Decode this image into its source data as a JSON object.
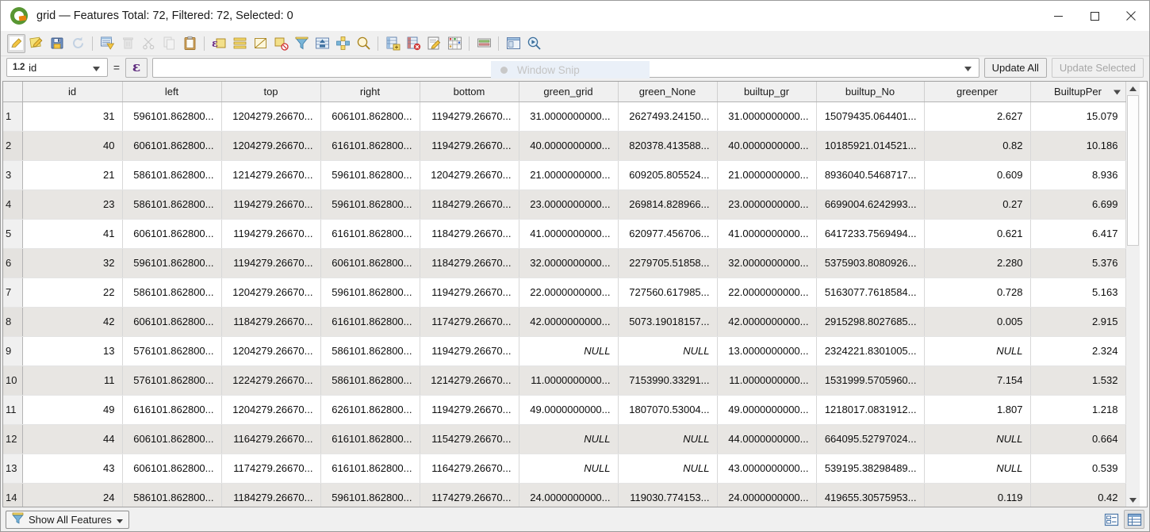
{
  "window": {
    "title": "grid — Features Total: 72, Filtered: 72, Selected: 0",
    "app_icon": "qgis-logo-icon",
    "minimize_label": "Minimize",
    "maximize_label": "Maximize",
    "close_label": "Close"
  },
  "toolbar": {
    "items": [
      {
        "name": "toggle-editing-icon",
        "tip": "Toggle editing mode",
        "state": "active"
      },
      {
        "name": "save-edits-icon",
        "tip": "Save edits",
        "state": "enabled"
      },
      {
        "name": "save-layer-edits-icon",
        "tip": "Save layer edits",
        "state": "enabled"
      },
      {
        "name": "reload-table-icon",
        "tip": "Reload the table",
        "state": "disabled"
      },
      {
        "name": "separator",
        "tip": "",
        "state": ""
      },
      {
        "name": "select-by-expression-icon",
        "tip": "Select features using an expression",
        "state": "enabled"
      },
      {
        "name": "delete-selected-icon",
        "tip": "Delete selected features",
        "state": "disabled"
      },
      {
        "name": "cut-features-icon",
        "tip": "Cut selected features to clipboard",
        "state": "disabled"
      },
      {
        "name": "copy-features-icon",
        "tip": "Copy selected features to clipboard",
        "state": "disabled"
      },
      {
        "name": "paste-features-icon",
        "tip": "Paste features from clipboard",
        "state": "enabled"
      },
      {
        "name": "separator",
        "tip": "",
        "state": ""
      },
      {
        "name": "select-all-icon",
        "tip": "Select all features",
        "state": "enabled"
      },
      {
        "name": "invert-selection-icon",
        "tip": "Invert selection",
        "state": "enabled"
      },
      {
        "name": "deselect-all-icon",
        "tip": "Deselect all features from the layer",
        "state": "enabled"
      },
      {
        "name": "deselect-current-layer-icon",
        "tip": "Deselect features from the current active layer",
        "state": "enabled"
      },
      {
        "name": "filter-select-icon",
        "tip": "Filter / Select features using form",
        "state": "enabled"
      },
      {
        "name": "move-selection-to-top-icon",
        "tip": "Move selection to top",
        "state": "enabled"
      },
      {
        "name": "pan-to-selected-icon",
        "tip": "Pan map to the selected rows",
        "state": "enabled"
      },
      {
        "name": "zoom-to-selected-icon",
        "tip": "Zoom map to the selected rows",
        "state": "enabled"
      },
      {
        "name": "separator",
        "tip": "",
        "state": ""
      },
      {
        "name": "new-field-icon",
        "tip": "New field",
        "state": "enabled"
      },
      {
        "name": "delete-field-icon",
        "tip": "Delete field",
        "state": "enabled"
      },
      {
        "name": "open-field-calculator-icon",
        "tip": "Open field calculator",
        "state": "enabled"
      },
      {
        "name": "conditional-formatting-icon",
        "tip": "Conditional formatting",
        "state": "enabled"
      },
      {
        "name": "separator",
        "tip": "",
        "state": ""
      },
      {
        "name": "organize-columns-icon",
        "tip": "Organize columns",
        "state": "enabled"
      },
      {
        "name": "separator",
        "tip": "",
        "state": ""
      },
      {
        "name": "dock-undock-icon",
        "tip": "Dock attribute table",
        "state": "enabled"
      },
      {
        "name": "actions-icon",
        "tip": "Actions",
        "state": "enabled"
      }
    ]
  },
  "expression_bar": {
    "field_type_badge": "1.2",
    "field_name": "id",
    "operator": "=",
    "expression_builder_glyph": "ε",
    "value": "",
    "value_placeholder": "",
    "update_all_label": "Update All",
    "update_selected_label": "Update Selected",
    "update_selected_enabled": false
  },
  "snip_overlay": {
    "label": "Window Snip"
  },
  "table": {
    "columns": [
      "id",
      "left",
      "top",
      "right",
      "bottom",
      "green_grid",
      "green_None",
      "builtup_gr",
      "builtup_No",
      "greenper",
      "BuiltupPer"
    ],
    "sorted_column": "BuiltupPer",
    "sort_direction": "desc",
    "rows": [
      {
        "n": "1",
        "cells": [
          "31",
          "596101.862800...",
          "1204279.26670...",
          "606101.862800...",
          "1194279.26670...",
          "31.0000000000...",
          "2627493.24150...",
          "31.0000000000...",
          "15079435.064401...",
          "2.627",
          "15.079"
        ]
      },
      {
        "n": "2",
        "cells": [
          "40",
          "606101.862800...",
          "1204279.26670...",
          "616101.862800...",
          "1194279.26670...",
          "40.0000000000...",
          "820378.413588...",
          "40.0000000000...",
          "10185921.014521...",
          "0.82",
          "10.186"
        ]
      },
      {
        "n": "3",
        "cells": [
          "21",
          "586101.862800...",
          "1214279.26670...",
          "596101.862800...",
          "1204279.26670...",
          "21.0000000000...",
          "609205.805524...",
          "21.0000000000...",
          "8936040.5468717...",
          "0.609",
          "8.936"
        ]
      },
      {
        "n": "4",
        "cells": [
          "23",
          "586101.862800...",
          "1194279.26670...",
          "596101.862800...",
          "1184279.26670...",
          "23.0000000000...",
          "269814.828966...",
          "23.0000000000...",
          "6699004.6242993...",
          "0.27",
          "6.699"
        ]
      },
      {
        "n": "5",
        "cells": [
          "41",
          "606101.862800...",
          "1194279.26670...",
          "616101.862800...",
          "1184279.26670...",
          "41.0000000000...",
          "620977.456706...",
          "41.0000000000...",
          "6417233.7569494...",
          "0.621",
          "6.417"
        ]
      },
      {
        "n": "6",
        "cells": [
          "32",
          "596101.862800...",
          "1194279.26670...",
          "606101.862800...",
          "1184279.26670...",
          "32.0000000000...",
          "2279705.51858...",
          "32.0000000000...",
          "5375903.8080926...",
          "2.280",
          "5.376"
        ]
      },
      {
        "n": "7",
        "cells": [
          "22",
          "586101.862800...",
          "1204279.26670...",
          "596101.862800...",
          "1194279.26670...",
          "22.0000000000...",
          "727560.617985...",
          "22.0000000000...",
          "5163077.7618584...",
          "0.728",
          "5.163"
        ]
      },
      {
        "n": "8",
        "cells": [
          "42",
          "606101.862800...",
          "1184279.26670...",
          "616101.862800...",
          "1174279.26670...",
          "42.0000000000...",
          "5073.19018157...",
          "42.0000000000...",
          "2915298.8027685...",
          "0.005",
          "2.915"
        ]
      },
      {
        "n": "9",
        "cells": [
          "13",
          "576101.862800...",
          "1204279.26670...",
          "586101.862800...",
          "1194279.26670...",
          "NULL",
          "NULL",
          "13.0000000000...",
          "2324221.8301005...",
          "NULL",
          "2.324"
        ]
      },
      {
        "n": "10",
        "cells": [
          "11",
          "576101.862800...",
          "1224279.26670...",
          "586101.862800...",
          "1214279.26670...",
          "11.0000000000...",
          "7153990.33291...",
          "11.0000000000...",
          "1531999.5705960...",
          "7.154",
          "1.532"
        ]
      },
      {
        "n": "11",
        "cells": [
          "49",
          "616101.862800...",
          "1204279.26670...",
          "626101.862800...",
          "1194279.26670...",
          "49.0000000000...",
          "1807070.53004...",
          "49.0000000000...",
          "1218017.0831912...",
          "1.807",
          "1.218"
        ]
      },
      {
        "n": "12",
        "cells": [
          "44",
          "606101.862800...",
          "1164279.26670...",
          "616101.862800...",
          "1154279.26670...",
          "NULL",
          "NULL",
          "44.0000000000...",
          "664095.52797024...",
          "NULL",
          "0.664"
        ]
      },
      {
        "n": "13",
        "cells": [
          "43",
          "606101.862800...",
          "1174279.26670...",
          "616101.862800...",
          "1164279.26670...",
          "NULL",
          "NULL",
          "43.0000000000...",
          "539195.38298489...",
          "NULL",
          "0.539"
        ]
      },
      {
        "n": "14",
        "cells": [
          "24",
          "586101.862800...",
          "1184279.26670...",
          "596101.862800...",
          "1174279.26670...",
          "24.0000000000...",
          "119030.774153...",
          "24.0000000000...",
          "419655.30575953...",
          "0.119",
          "0.42"
        ]
      }
    ]
  },
  "statusbar": {
    "filter_label": "Show All Features",
    "filter_icon": "funnel-icon",
    "form_view_label": "Switch to form view",
    "table_view_label": "Switch to table view"
  },
  "colors": {
    "accent": "#589632",
    "accent_secondary": "#e8820c",
    "row_alt": "#e8e6e3",
    "null_text": "#9a9a9a",
    "chrome": "#f0f0f0"
  }
}
